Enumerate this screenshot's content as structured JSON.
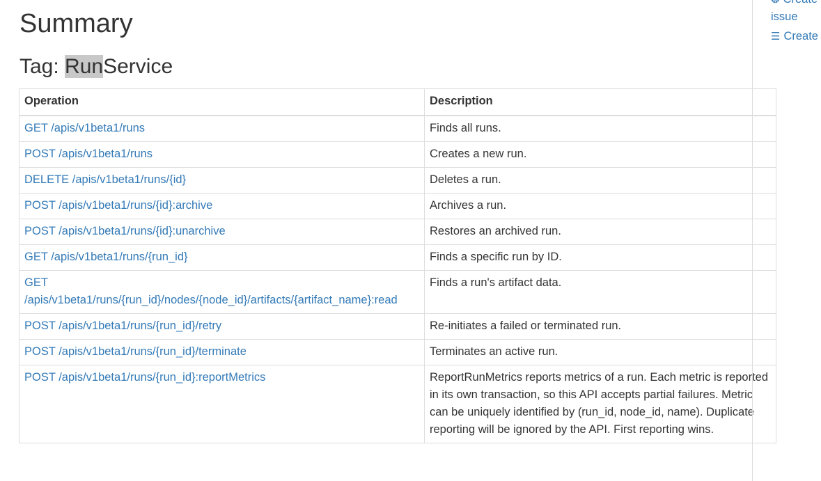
{
  "summary_title": "Summary",
  "tag": {
    "prefix": "Tag: ",
    "highlight": "Run",
    "rest": "Service"
  },
  "table": {
    "headers": {
      "operation": "Operation",
      "description": "Description"
    },
    "rows": [
      {
        "operation": "GET /apis/v1beta1/runs",
        "description": "Finds all runs."
      },
      {
        "operation": "POST /apis/v1beta1/runs",
        "description": "Creates a new run."
      },
      {
        "operation": "DELETE /apis/v1beta1/runs/{id}",
        "description": "Deletes a run."
      },
      {
        "operation": "POST /apis/v1beta1/runs/{id}:archive",
        "description": "Archives a run."
      },
      {
        "operation": "POST /apis/v1beta1/runs/{id}:unarchive",
        "description": "Restores an archived run."
      },
      {
        "operation": "GET /apis/v1beta1/runs/{run_id}",
        "description": "Finds a specific run by ID."
      },
      {
        "operation": "GET /apis/v1beta1/runs/{run_id}/nodes/{node_id}/artifacts/{artifact_name}:read",
        "description": "Finds a run's artifact data."
      },
      {
        "operation": "POST /apis/v1beta1/runs/{run_id}/retry",
        "description": "Re-initiates a failed or terminated run."
      },
      {
        "operation": "POST /apis/v1beta1/runs/{run_id}/terminate",
        "description": "Terminates an active run."
      },
      {
        "operation": "POST /apis/v1beta1/runs/{run_id}:reportMetrics",
        "description": "ReportRunMetrics reports metrics of a run. Each metric is reported in its own transaction, so this API accepts partial failures. Metric can be uniquely identified by (run_id, node_id, name). Duplicate reporting will be ignored by the API. First reporting wins."
      }
    ]
  },
  "right_panel": {
    "create_issue_label": "Create",
    "create_issue_label_2": "issue",
    "create_task_label": "Create"
  }
}
